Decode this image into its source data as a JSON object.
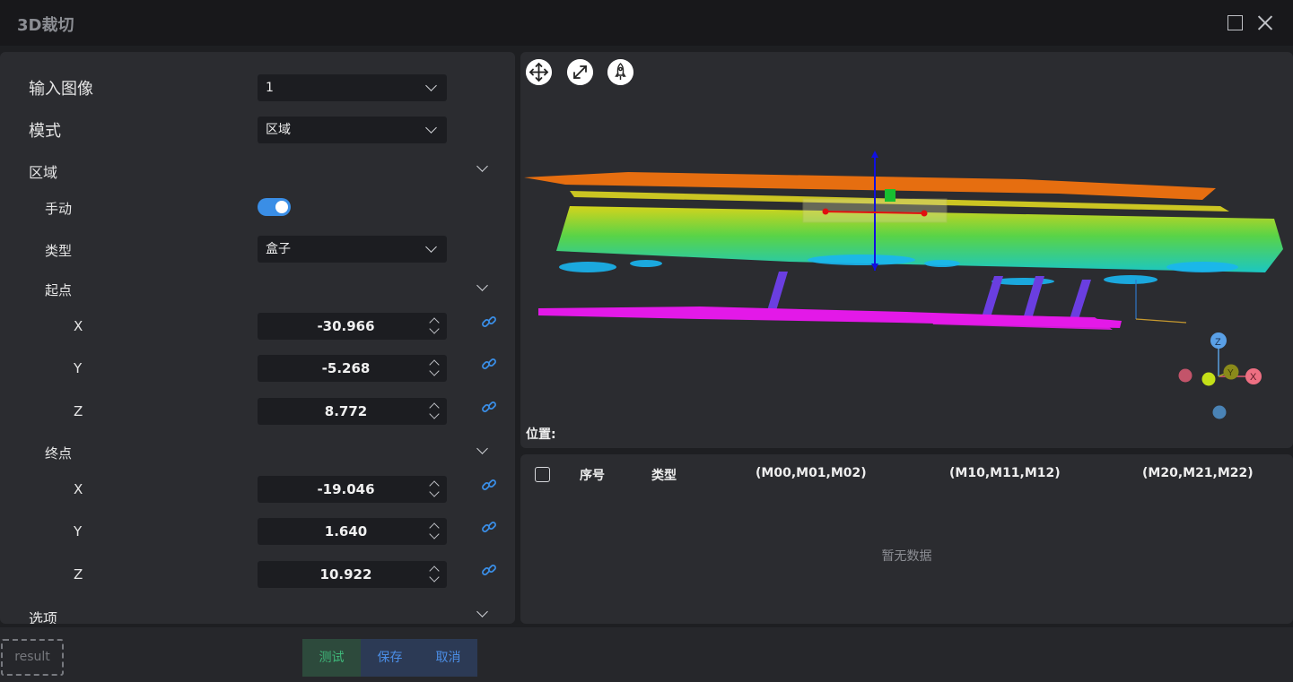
{
  "window": {
    "title": "3D裁切"
  },
  "left": {
    "input_image_label": "输入图像",
    "input_image_value": "1",
    "mode_label": "模式",
    "mode_value": "区域",
    "region_section": "区域",
    "manual_label": "手动",
    "manual_on": true,
    "type_label": "类型",
    "type_value": "盒子",
    "start_section": "起点",
    "start": [
      {
        "axis": "X",
        "value": "-30.966"
      },
      {
        "axis": "Y",
        "value": "-5.268"
      },
      {
        "axis": "Z",
        "value": "8.772"
      }
    ],
    "end_section": "终点",
    "end": [
      {
        "axis": "X",
        "value": "-19.046"
      },
      {
        "axis": "Y",
        "value": "1.640"
      },
      {
        "axis": "Z",
        "value": "10.922"
      }
    ],
    "options_section": "选项"
  },
  "viewer": {
    "position_label": "位置:",
    "tools": [
      "move-arrows-icon",
      "expand-icon",
      "rocket-icon"
    ],
    "gizmo_labels": {
      "z": "Z",
      "y": "Y",
      "x": "X"
    }
  },
  "table": {
    "columns": [
      "序号",
      "类型",
      "(M00,M01,M02)",
      "(M10,M11,M12)",
      "(M20,M21,M22)"
    ],
    "empty_text": "暂无数据"
  },
  "footer": {
    "result_label": "result",
    "test_label": "测试",
    "save_label": "保存",
    "cancel_label": "取消"
  },
  "colors": {
    "accent": "#3a8ee6",
    "panel": "#2b2c30",
    "background": "#1e1f22",
    "test_green": "#3fb87a",
    "button_blue": "#4b8ee6"
  }
}
